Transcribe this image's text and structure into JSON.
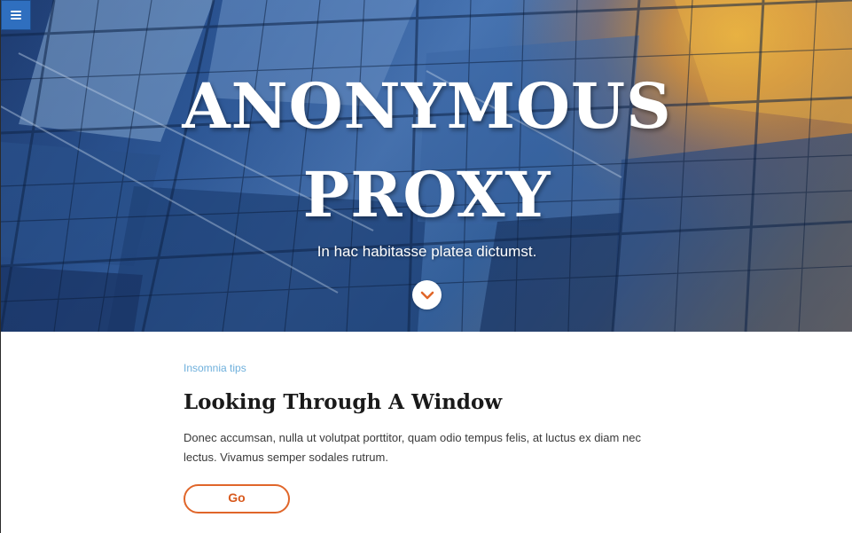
{
  "header": {
    "menu_icon": "hamburger-menu-icon",
    "title_line_1": "ANONYMOUS",
    "title_line_2": "PROXY",
    "subtitle": "In hac habitasse platea dictumst.",
    "scroll_icon": "chevron-down-icon"
  },
  "article": {
    "category": "Insomnia tips",
    "title": "Looking Through A Window",
    "body": "Donec accumsan, nulla ut volutpat porttitor, quam odio tempus felis, at luctus ex diam nec lectus. Vivamus semper sodales rutrum.",
    "button_label": "Go"
  },
  "colors": {
    "menu_button": "#2f6fbf",
    "accent": "#e0662a",
    "category": "#6fb0dc"
  }
}
